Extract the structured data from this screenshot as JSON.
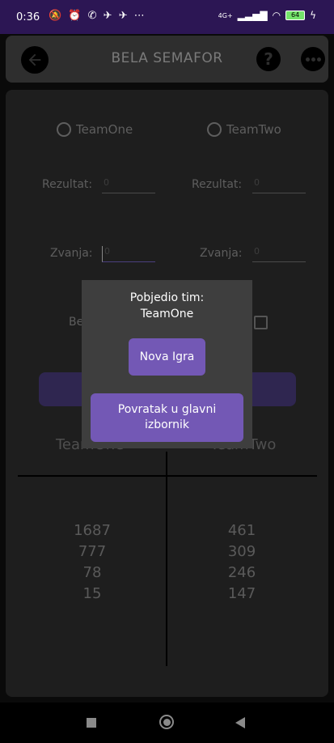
{
  "status_bar": {
    "time": "0:36",
    "left_icons": "🔕 ⏰ ✆ ✈ ✈ ⋯",
    "network": "4G+",
    "battery": "64",
    "icons": [
      "mute-icon",
      "alarm-icon",
      "whatsapp-icon",
      "telegram-icon",
      "signal-icon",
      "wifi-icon",
      "battery-icon",
      "charging-icon"
    ]
  },
  "app_bar": {
    "title": "BELA SEMAFOR"
  },
  "teams": {
    "team_one": "TeamOne",
    "team_two": "TeamTwo"
  },
  "form": {
    "rezultat_label": "Rezultat:",
    "zvanja_label": "Zvanja:",
    "bela_label_partial": "Be",
    "rezultat_one_placeholder": "0",
    "rezultat_two_placeholder": "0",
    "zvanja_one_placeholder": "0",
    "zvanja_two_placeholder": "0"
  },
  "score_table": {
    "header_one": "TeamOne",
    "header_two": "TeamTwo",
    "team_one_scores": [
      "1687",
      "777",
      "78",
      "15"
    ],
    "team_two_scores": [
      "461",
      "309",
      "246",
      "147"
    ]
  },
  "dialog": {
    "message_line1": "Pobjedio tim:",
    "message_line2": "TeamOne",
    "new_game_label": "Nova Igra",
    "main_menu_line1": "Povratak u glavni",
    "main_menu_line2": "izbornik"
  },
  "colors": {
    "status_bar": "#2c1654",
    "accent": "#7358b5",
    "dialog_bg": "#3e3e3e",
    "panel_bg": "#1e1e1e"
  }
}
